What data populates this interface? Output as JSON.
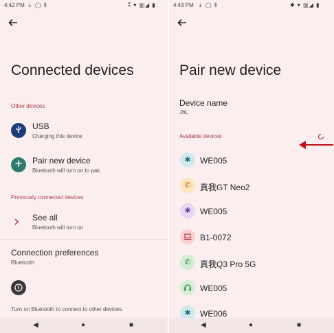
{
  "left": {
    "status": {
      "time": "4:42 PM",
      "icons_left": "⇣ ◯ ⦀",
      "icons_right": "⁑ ▾ ▥◢ ▮"
    },
    "title": "Connected devices",
    "sections": {
      "other": "Other devices",
      "previous": "Previously connected devices"
    },
    "usb": {
      "title": "USB",
      "subtitle": "Charging this device"
    },
    "pair": {
      "title": "Pair new device",
      "subtitle": "Bluetooth will turn on to pair"
    },
    "see_all": {
      "title": "See all",
      "subtitle": "Bluetooth will turn on"
    },
    "conn_prefs": {
      "title": "Connection preferences",
      "subtitle": "Bluetooth"
    },
    "footer_text": "Turn on Bluetooth to connect to other devices."
  },
  "right": {
    "status": {
      "time": "4:43 PM",
      "icons_left": "⇣ ◯ ⦀",
      "icons_right": "✱ ▾ ▥◢ ▮"
    },
    "title": "Pair new device",
    "device_name_label": "Device name",
    "device_name_value": "J6L",
    "available_label": "Available devices",
    "devices": [
      {
        "name": "WE005",
        "icon": "bluetooth-icon"
      },
      {
        "name": "真我GT Neo2",
        "icon": "phone-icon"
      },
      {
        "name": "WE005",
        "icon": "bluetooth-icon"
      },
      {
        "name": "B1-0072",
        "icon": "laptop-icon"
      },
      {
        "name": "真我Q3 Pro 5G",
        "icon": "phone-icon"
      },
      {
        "name": "WE005",
        "icon": "headphones-icon"
      },
      {
        "name": "WE006",
        "icon": "bluetooth-icon"
      }
    ]
  },
  "nav": {
    "back_icon": "back-triangle-icon",
    "home_icon": "home-circle-icon",
    "recents_icon": "recents-square-icon"
  },
  "colors": {
    "background": "#fbeeee",
    "accent": "#a3404b",
    "arrow": "#c0121c"
  }
}
